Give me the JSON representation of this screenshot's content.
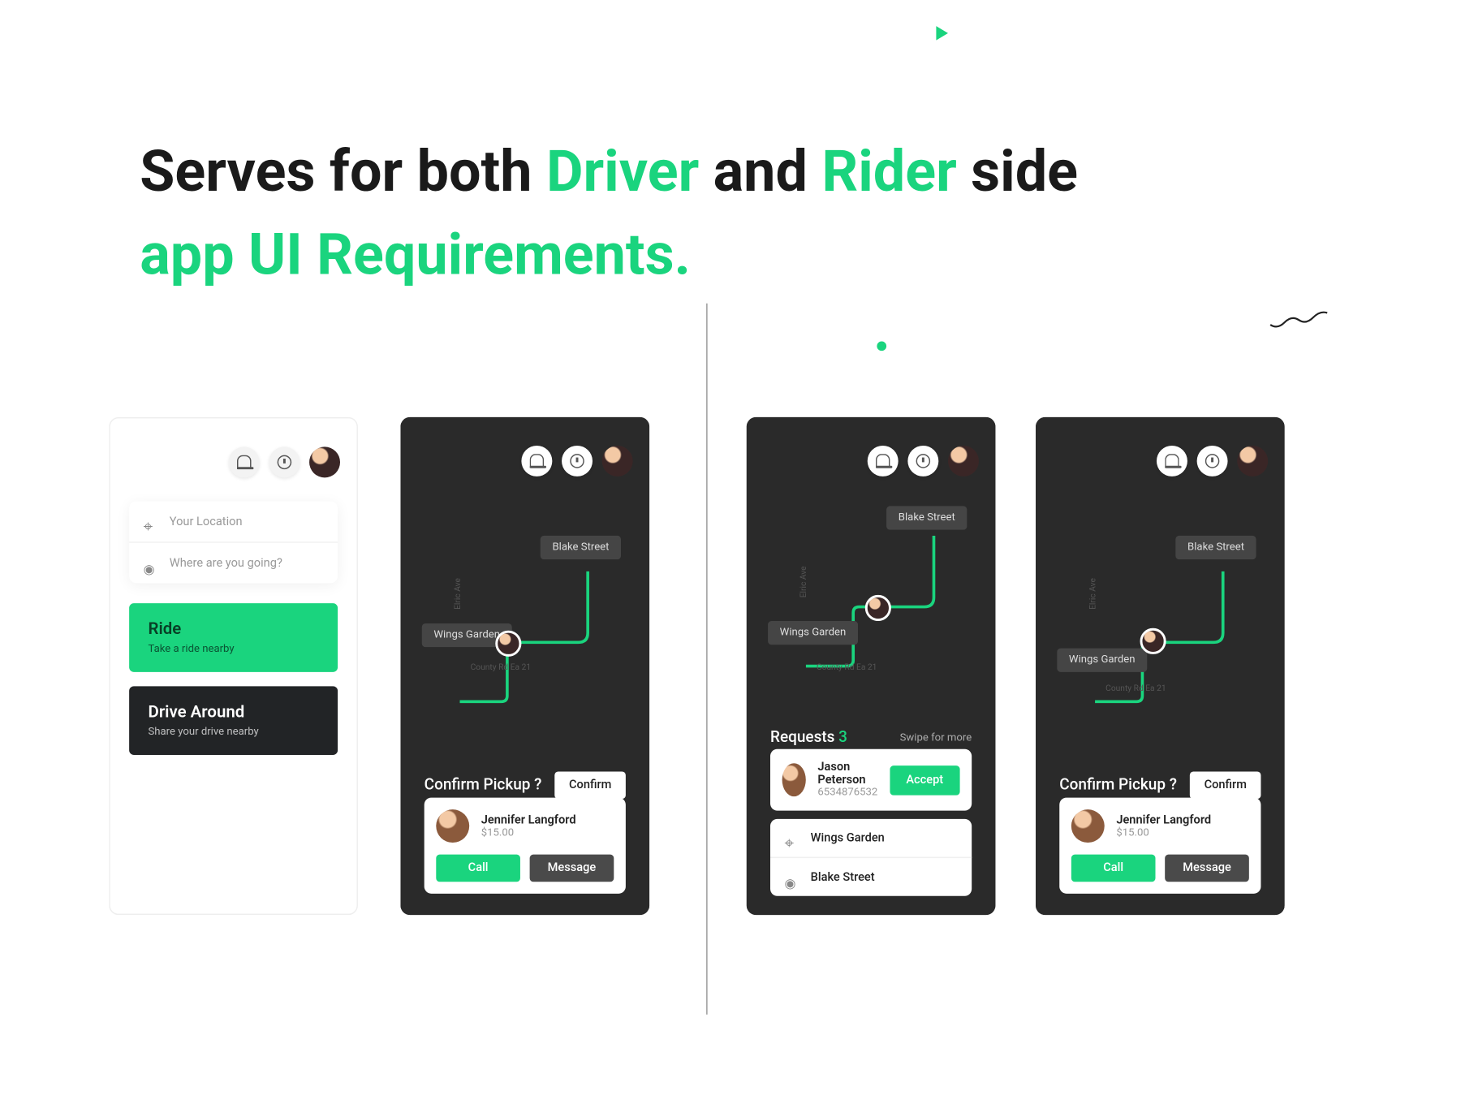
{
  "headline": {
    "part1": "Serves for both ",
    "accent1": "Driver",
    "part2": " and ",
    "accent2": "Rider",
    "part3": " side",
    "line2": "app UI Requirements."
  },
  "rider": {
    "input1_placeholder": "Your Location",
    "input2_placeholder": "Where are you going?",
    "ride_title": "Ride",
    "ride_sub": "Take a ride nearby",
    "drive_title": "Drive Around",
    "drive_sub": "Share your drive nearby"
  },
  "map": {
    "street1": "Blake Street",
    "street2": "Wings Garden",
    "road1": "Elric Ave",
    "road2": "County Rd Ea 21"
  },
  "confirm": {
    "title": "Confirm Pickup ?",
    "button": "Confirm",
    "user_name": "Jennifer Langford",
    "user_price": "$15.00",
    "call": "Call",
    "message": "Message"
  },
  "requests": {
    "title": "Requests",
    "count": "3",
    "swipe": "Swipe for more",
    "rider_name": "Jason Peterson",
    "rider_code": "6534876532",
    "accept": "Accept",
    "loc1": "Wings Garden",
    "loc2": "Blake Street"
  }
}
